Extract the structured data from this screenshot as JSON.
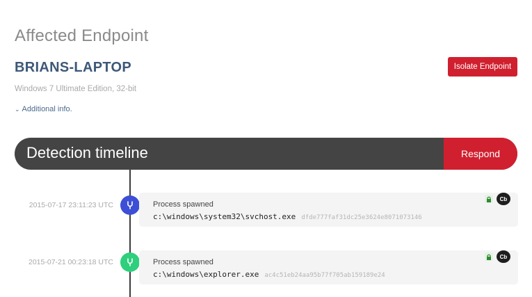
{
  "endpoint": {
    "section_title": "Affected Endpoint",
    "hostname": "BRIANS-LAPTOP",
    "os": "Windows 7 Ultimate Edition, 32-bit",
    "additional_info": "Additional info.",
    "isolate_label": "Isolate Endpoint"
  },
  "timeline": {
    "title": "Detection timeline",
    "respond_label": "Respond",
    "events": [
      {
        "timestamp": "2015-07-17 23:11:23 UTC",
        "type": "Process spawned",
        "path": "c:\\windows\\system32\\svchost.exe",
        "hash": "dfde777faf31dc25e3624e8071073146",
        "node_color": "#3d4fd6",
        "icon": "process-fork-icon",
        "badge": "Cb"
      },
      {
        "timestamp": "2015-07-21 00:23:18 UTC",
        "type": "Process spawned",
        "path": "c:\\windows\\explorer.exe",
        "hash": "ac4c51eb24aa95b77f705ab159189e24",
        "node_color": "#2ecf7d",
        "icon": "process-fork-icon",
        "badge": "Cb"
      }
    ]
  },
  "colors": {
    "accent_red": "#d0202f",
    "dark_bar": "#444444",
    "hostname_blue": "#3d5878",
    "lock_green": "#2e8b2e"
  }
}
